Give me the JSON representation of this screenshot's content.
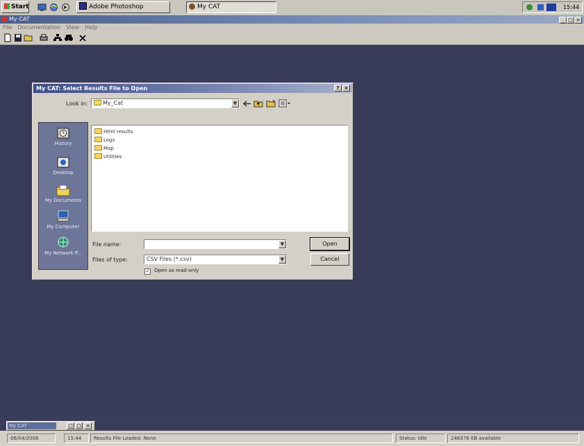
{
  "taskbar": {
    "start_label": "Start",
    "tasks": [
      {
        "label": "Adobe Photoshop"
      },
      {
        "label": "My CAT"
      }
    ],
    "clock": "15:44"
  },
  "app": {
    "title": "My CAT",
    "menu": [
      "File",
      "Documentation",
      "View",
      "Help"
    ]
  },
  "dialog": {
    "title": "My CAT: Select Results File to Open",
    "look_in_label": "Look in:",
    "look_in_value": "My_Cat",
    "places": [
      "History",
      "Desktop",
      "My Documents",
      "My Computer",
      "My Network P..."
    ],
    "folders": [
      "Html results",
      "Logs",
      "Map",
      "Utilities"
    ],
    "file_name_label": "File name:",
    "file_name_value": "",
    "file_type_label": "Files of type:",
    "file_type_value": "CSV Files (*.csv)",
    "readonly_label": "Open as read-only",
    "readonly_checked": true,
    "open_label": "Open",
    "cancel_label": "Cancel"
  },
  "minimized": {
    "title": "My CAT"
  },
  "status_bar": {
    "date": "06/04/2008",
    "time": "15:44",
    "message": "Results File Loaded: None",
    "status_label": "Status: Idle",
    "memory": "248376 KB available"
  }
}
